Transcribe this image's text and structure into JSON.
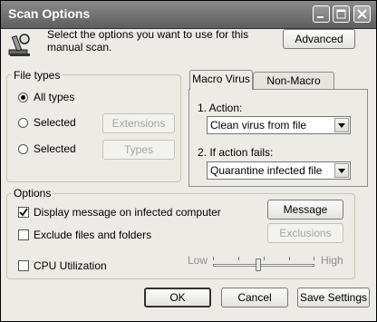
{
  "window": {
    "title": "Scan Options"
  },
  "header": {
    "description": "Select the options you want to use for this manual scan.",
    "advanced_label": "Advanced"
  },
  "file_types": {
    "group_label": "File types",
    "all_types_label": "All types",
    "selected_label_1": "Selected",
    "extensions_label": "Extensions",
    "selected_label_2": "Selected",
    "types_label": "Types",
    "selected_option": "All types"
  },
  "tabs": {
    "macro_virus": "Macro Virus",
    "non_macro_virus": "Non-Macro Virus",
    "active": "Macro Virus"
  },
  "macro_panel": {
    "action_label": "1. Action:",
    "action_value": "Clean virus from file",
    "fail_label": "2. If action fails:",
    "fail_value": "Quarantine infected file"
  },
  "options": {
    "group_label": "Options",
    "display_message_label": "Display message on infected computer",
    "display_message_checked": true,
    "exclude_label": "Exclude files and folders",
    "exclude_checked": false,
    "cpu_label": "CPU Utilization",
    "cpu_checked": false,
    "message_button": "Message",
    "exclusions_button": "Exclusions",
    "low_label": "Low",
    "high_label": "High",
    "cpu_level_fraction": 0.45
  },
  "footer": {
    "ok_label": "OK",
    "cancel_label": "Cancel",
    "save_label": "Save Settings"
  }
}
